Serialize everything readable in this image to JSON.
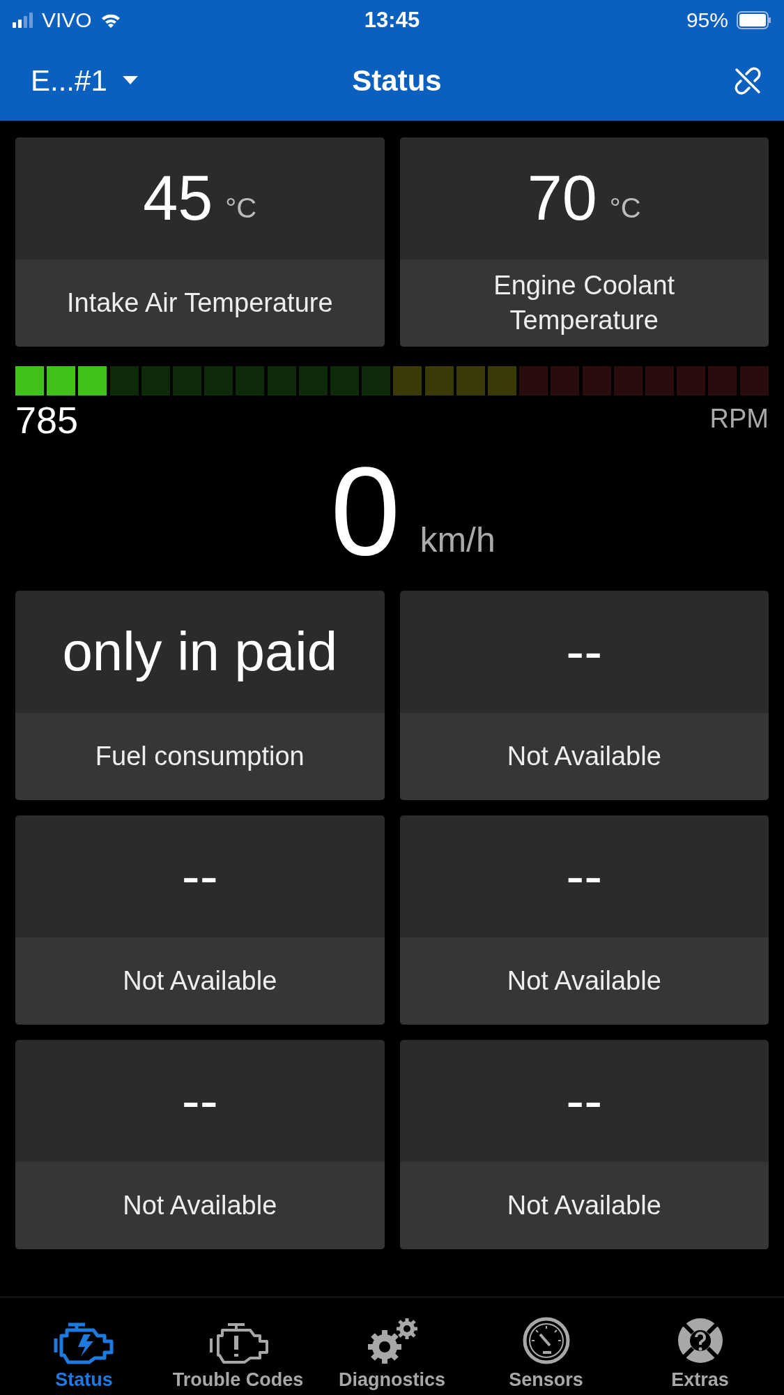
{
  "status_bar": {
    "carrier": "VIVO",
    "time": "13:45",
    "battery": "95%"
  },
  "header": {
    "vehicle": "E...#1",
    "title": "Status"
  },
  "top_tiles": [
    {
      "value": "45",
      "unit": "°C",
      "label": "Intake Air Temperature"
    },
    {
      "value": "70",
      "unit": "°C",
      "label": "Engine Coolant Temperature"
    }
  ],
  "rpm": {
    "level": 0.125,
    "reading": "785",
    "unit": "RPM"
  },
  "speed": {
    "value": "0",
    "unit": "km/h"
  },
  "tiles": [
    {
      "value": "only in paid",
      "label": "Fuel consumption"
    },
    {
      "value": "--",
      "label": "Not Available"
    },
    {
      "value": "--",
      "label": "Not Available"
    },
    {
      "value": "--",
      "label": "Not Available"
    },
    {
      "value": "--",
      "label": "Not Available"
    },
    {
      "value": "--",
      "label": "Not Available"
    }
  ],
  "tab_bar": [
    {
      "kind": "status",
      "label": "Status",
      "selected": true
    },
    {
      "kind": "trouble",
      "label": "Trouble Codes",
      "selected": false
    },
    {
      "kind": "diagnostics",
      "label": "Diagnostics",
      "selected": false
    },
    {
      "kind": "sensors",
      "label": "Sensors",
      "selected": false
    },
    {
      "kind": "extras",
      "label": "Extras",
      "selected": false
    }
  ]
}
